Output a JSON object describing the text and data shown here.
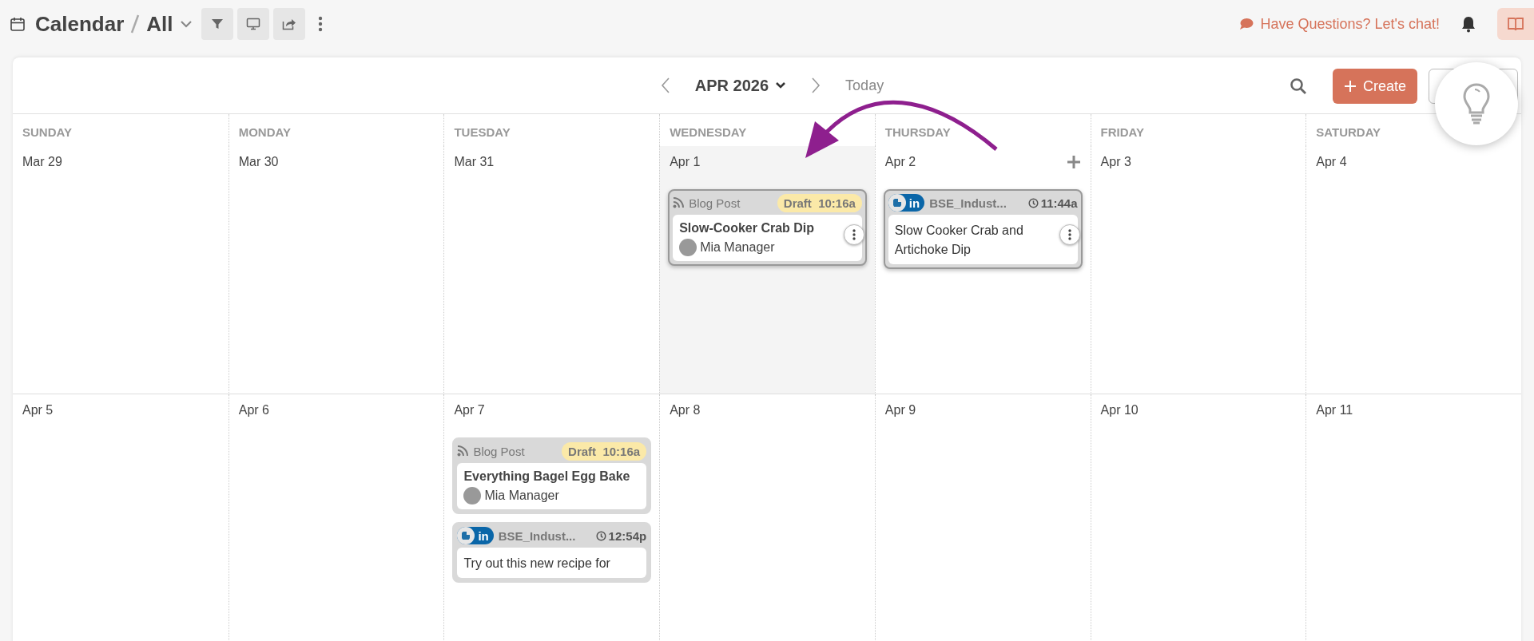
{
  "header": {
    "title": "Calendar",
    "view": "All",
    "chat": "Have Questions? Let's chat!"
  },
  "toolbar": {
    "month": "APR 2026",
    "today": "Today",
    "create": "Create"
  },
  "weekdays": [
    "SUNDAY",
    "MONDAY",
    "TUESDAY",
    "WEDNESDAY",
    "THURSDAY",
    "FRIDAY",
    "SATURDAY"
  ],
  "weeks": [
    {
      "days": [
        {
          "date": "Mar 29",
          "selected": false,
          "add_button": false
        },
        {
          "date": "Mar 30",
          "selected": false,
          "add_button": false
        },
        {
          "date": "Mar 31",
          "selected": false,
          "add_button": false
        },
        {
          "date": "Apr 1",
          "selected": true,
          "add_button": false,
          "events": [
            {
              "kind": "blog",
              "category": "Blog Post",
              "status": "Draft",
              "time": "10:16a",
              "title": "Slow-Cooker Crab Dip",
              "author": "Mia Manager",
              "hovered": true
            }
          ]
        },
        {
          "date": "Apr 2",
          "selected": false,
          "add_button": true,
          "events": [
            {
              "kind": "social",
              "network": "in",
              "account": "BSE_Indust...",
              "time": "11:44a",
              "text": "Slow Cooker Crab and Artichoke Dip",
              "hovered": true
            }
          ]
        },
        {
          "date": "Apr 3",
          "selected": false,
          "add_button": false
        },
        {
          "date": "Apr 4",
          "selected": false,
          "add_button": false
        }
      ]
    },
    {
      "days": [
        {
          "date": "Apr 5",
          "selected": false,
          "add_button": false
        },
        {
          "date": "Apr 6",
          "selected": false,
          "add_button": false
        },
        {
          "date": "Apr 7",
          "selected": false,
          "add_button": false,
          "events": [
            {
              "kind": "blog",
              "category": "Blog Post",
              "status": "Draft",
              "time": "10:16a",
              "title": "Everything Bagel Egg Bake",
              "author": "Mia Manager",
              "hovered": false
            },
            {
              "kind": "social",
              "network": "in",
              "account": "BSE_Indust...",
              "time": "12:54p",
              "text": "Try out this new recipe for",
              "hovered": false
            }
          ]
        },
        {
          "date": "Apr 8",
          "selected": false,
          "add_button": false
        },
        {
          "date": "Apr 9",
          "selected": false,
          "add_button": false
        },
        {
          "date": "Apr 10",
          "selected": false,
          "add_button": false
        },
        {
          "date": "Apr 11",
          "selected": false,
          "add_button": false
        }
      ]
    }
  ]
}
